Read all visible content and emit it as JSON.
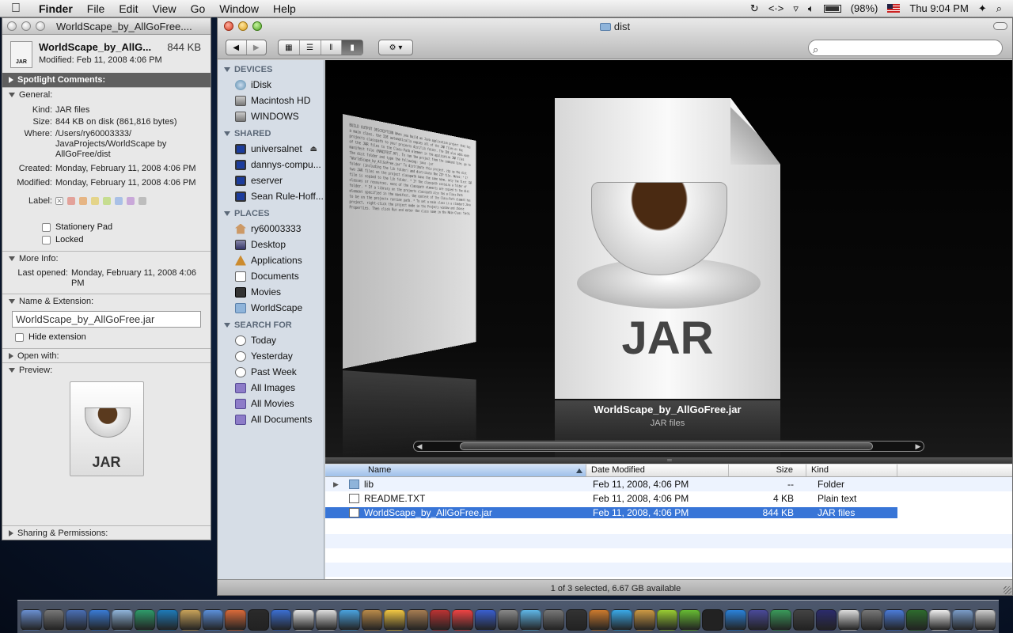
{
  "menubar": {
    "app_name": "Finder",
    "menus": [
      "File",
      "Edit",
      "View",
      "Go",
      "Window",
      "Help"
    ],
    "battery": "(98%)",
    "clock": "Thu 9:04 PM"
  },
  "info_window": {
    "title": "WorldScape_by_AllGoFree....",
    "file_name": "WorldScape_by_AllG...",
    "file_size": "844 KB",
    "modified_line": "Modified: Feb 11, 2008 4:06 PM",
    "spotlight_header": "Spotlight Comments:",
    "general_header": "General:",
    "kind_label": "Kind:",
    "kind_value": "JAR files",
    "size_label": "Size:",
    "size_value": "844 KB on disk (861,816 bytes)",
    "where_label": "Where:",
    "where_value": "/Users/ry60003333/ JavaProjects/WorldScape by AllGoFree/dist",
    "created_label": "Created:",
    "created_value": "Monday, February 11, 2008 4:06 PM",
    "modified_label": "Modified:",
    "modified_value": "Monday, February 11, 2008 4:06 PM",
    "label_label": "Label:",
    "label_colors": [
      "#e3a29a",
      "#e6b584",
      "#e4d489",
      "#c6dd90",
      "#a9c0e6",
      "#c9a8d9",
      "#bdbdbd"
    ],
    "stationery": "Stationery Pad",
    "locked": "Locked",
    "more_info_header": "More Info:",
    "last_opened_label": "Last opened:",
    "last_opened_value": "Monday, February 11, 2008 4:06 PM",
    "name_ext_header": "Name & Extension:",
    "name_ext_value": "WorldScape_by_AllGoFree.jar",
    "hide_ext": "Hide extension",
    "open_with_header": "Open with:",
    "preview_header": "Preview:",
    "preview_label": "JAR",
    "sharing_header": "Sharing & Permissions:"
  },
  "finder": {
    "title": "dist",
    "search_placeholder": "",
    "sidebar": {
      "devices_header": "DEVICES",
      "devices": [
        {
          "label": "iDisk",
          "icon": "idisk-icon"
        },
        {
          "label": "Macintosh HD",
          "icon": "hard-disk-icon"
        },
        {
          "label": "WINDOWS",
          "icon": "hard-disk-icon"
        }
      ],
      "shared_header": "SHARED",
      "shared": [
        {
          "label": "universalnet",
          "icon": "monitor-icon"
        },
        {
          "label": "dannys-compu...",
          "icon": "monitor-icon"
        },
        {
          "label": "eserver",
          "icon": "monitor-icon"
        },
        {
          "label": "Sean Rule-Hoff...",
          "icon": "monitor-icon"
        }
      ],
      "places_header": "PLACES",
      "places": [
        {
          "label": "ry60003333",
          "icon": "home-icon"
        },
        {
          "label": "Desktop",
          "icon": "desktop-icon"
        },
        {
          "label": "Applications",
          "icon": "applications-icon"
        },
        {
          "label": "Documents",
          "icon": "documents-icon"
        },
        {
          "label": "Movies",
          "icon": "movies-icon"
        },
        {
          "label": "WorldScape",
          "icon": "folder-icon"
        }
      ],
      "search_header": "SEARCH FOR",
      "search": [
        {
          "label": "Today",
          "icon": "clock-icon"
        },
        {
          "label": "Yesterday",
          "icon": "clock-icon"
        },
        {
          "label": "Past Week",
          "icon": "clock-icon"
        },
        {
          "label": "All Images",
          "icon": "smart-folder-icon"
        },
        {
          "label": "All Movies",
          "icon": "smart-folder-icon"
        },
        {
          "label": "All Documents",
          "icon": "smart-folder-icon"
        }
      ]
    },
    "coverflow": {
      "doc_text": "BUILD OUTPUT DESCRIPTION  When you build an Java application project that has a main class, the IDE automatically copies all of the JAR files on the projects classpath to your projects dist/lib folder. The IDE also adds each of the JAR files to the Class-Path element in the application JAR files manifest file (MANIFEST.MF). To run the project from the command line, go to the dist folder and type the following: java -jar \"WorldScape_by_AllGoFree.jar\" To distribute this project, zip up the dist folder (including the lib folder) and distribute the ZIP file. Notes: * If two JAR files on the project classpath have the same name, only the first JAR file is copied to the lib folder. * If the classpath contains a folder of classes or resources, none of the classpath elements are copied to the dist folder. * If a library on the projects classpath also has a Class-Path element specified in the manifest, the content of the Class-Path element has to be on the projects runtime path. * To set a main class in a standard Java project, right-click the project node in the Projects window and choose Properties. Then click Run and enter the class name in the Main Class field.",
      "main_label": "JAR",
      "caption_name": "WorldScape_by_AllGoFree.jar",
      "caption_kind": "JAR files"
    },
    "columns": {
      "name": "Name",
      "date": "Date Modified",
      "size": "Size",
      "kind": "Kind"
    },
    "rows": [
      {
        "name": "lib",
        "date": "Feb 11, 2008, 4:06 PM",
        "size": "--",
        "kind": "Folder"
      },
      {
        "name": "README.TXT",
        "date": "Feb 11, 2008, 4:06 PM",
        "size": "4 KB",
        "kind": "Plain text"
      },
      {
        "name": "WorldScape_by_AllGoFree.jar",
        "date": "Feb 11, 2008, 4:06 PM",
        "size": "844 KB",
        "kind": "JAR files"
      }
    ],
    "status": "1 of 3 selected, 6.67 GB available"
  },
  "colors": {
    "selection": "#3875d7",
    "sidebar_bg": "#d6dde6"
  }
}
